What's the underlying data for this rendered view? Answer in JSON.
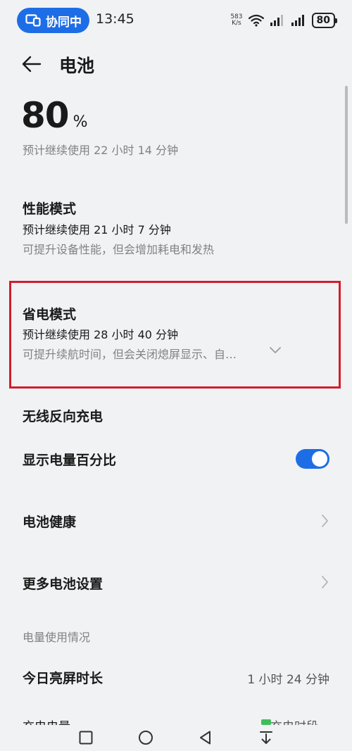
{
  "status_bar": {
    "collab_label": "协同中",
    "time": "13:45",
    "net_speed_value": "583",
    "net_speed_unit": "K/s",
    "battery_level": "80"
  },
  "header": {
    "title": "电池"
  },
  "battery": {
    "percent": "80",
    "unit": "%",
    "remaining": "预计继续使用 22 小时 14 分钟"
  },
  "modes": {
    "performance": {
      "title": "性能模式",
      "estimate": "预计继续使用 21 小时 7 分钟",
      "description": "可提升设备性能，但会增加耗电和发热"
    },
    "power_saving": {
      "title": "省电模式",
      "estimate": "预计继续使用 28 小时 40 分钟",
      "description": "可提升续航时间，但会关闭熄屏显示、自…"
    }
  },
  "settings": {
    "reverse_charging": "无线反向充电",
    "show_percentage": "显示电量百分比",
    "show_percentage_on": true,
    "battery_health": "电池健康",
    "more_settings": "更多电池设置"
  },
  "usage": {
    "section_title": "电量使用情况",
    "screen_on_label": "今日亮屏时长",
    "screen_on_value": "1 小时 24 分钟",
    "next_label": "充电电量",
    "next_value": "充电时段"
  },
  "colors": {
    "accent": "#1d6ee6",
    "highlight": "#d41c2c",
    "background": "#f1f2f4",
    "secondary_text": "#808285"
  }
}
